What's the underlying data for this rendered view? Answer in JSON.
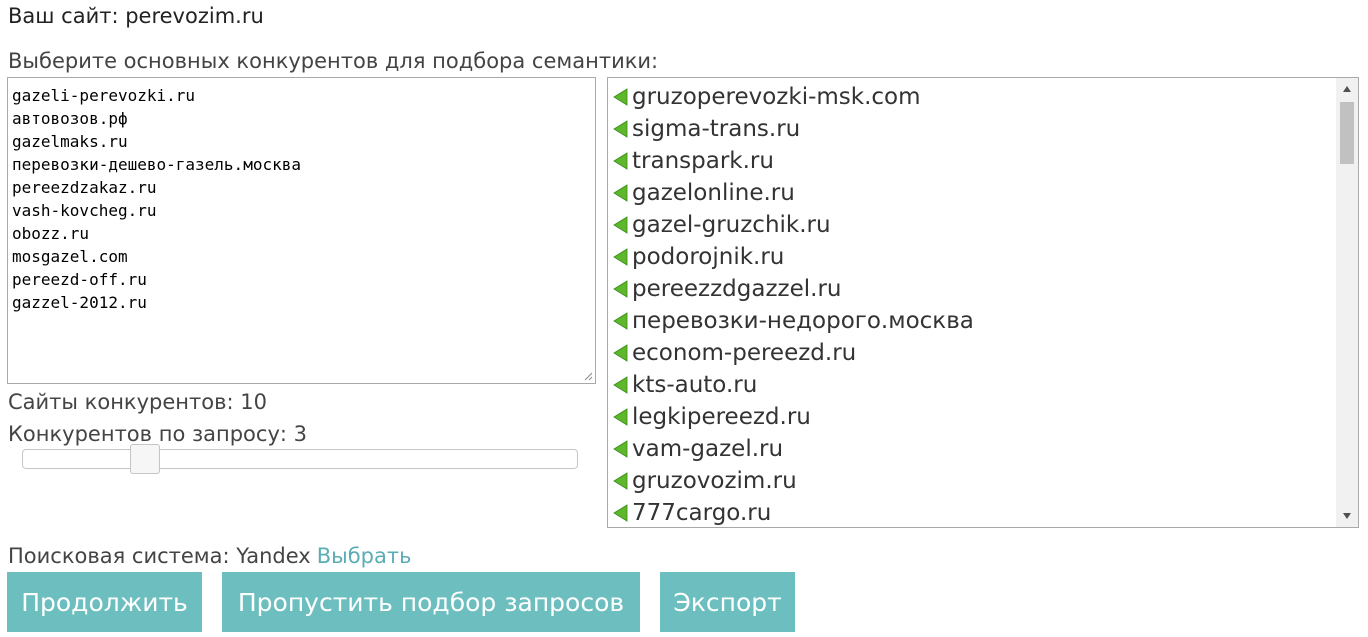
{
  "header": {
    "site_label": "Ваш сайт: perevozim.ru"
  },
  "competitors": {
    "prompt": "Выберите основных конкурентов для подбора семантики:",
    "lines": [
      "gazeli-perevozki.ru",
      "автовозов.рф",
      "gazelmaks.ru",
      "перевозки-дешево-газель.москва",
      "pereezdzakaz.ru",
      "vash-kovcheg.ru",
      "obozz.ru",
      "mosgazel.com",
      "pereezd-off.ru",
      "gazzel-2012.ru"
    ],
    "count_text": "Сайты конкурентов: 10",
    "per_query_text": "Конкурентов по запросу: 3",
    "per_query_value": 3,
    "slider_fraction": 0.22
  },
  "suggestions": {
    "arrow_color": "#5cb82a",
    "arrow_icon": "arrow-left-icon",
    "items": [
      "gruzoperevozki-msk.com",
      "sigma-trans.ru",
      "transpark.ru",
      "gazelonline.ru",
      "gazel-gruzchik.ru",
      "podorojnik.ru",
      "pereezzdgazzel.ru",
      "перевозки-недорого.москва",
      "econom-pereezd.ru",
      "kts-auto.ru",
      "legkipereezd.ru",
      "vam-gazel.ru",
      "gruzovozim.ru",
      "777cargo.ru"
    ]
  },
  "search_engine": {
    "label": "Поисковая система: Yandex",
    "link": "Выбрать"
  },
  "buttons": {
    "continue": "Продолжить",
    "skip": "Пропустить подбор запросов",
    "export": "Экспорт"
  },
  "colors": {
    "button_bg": "#6dbfbf",
    "link": "#5aadb4"
  }
}
